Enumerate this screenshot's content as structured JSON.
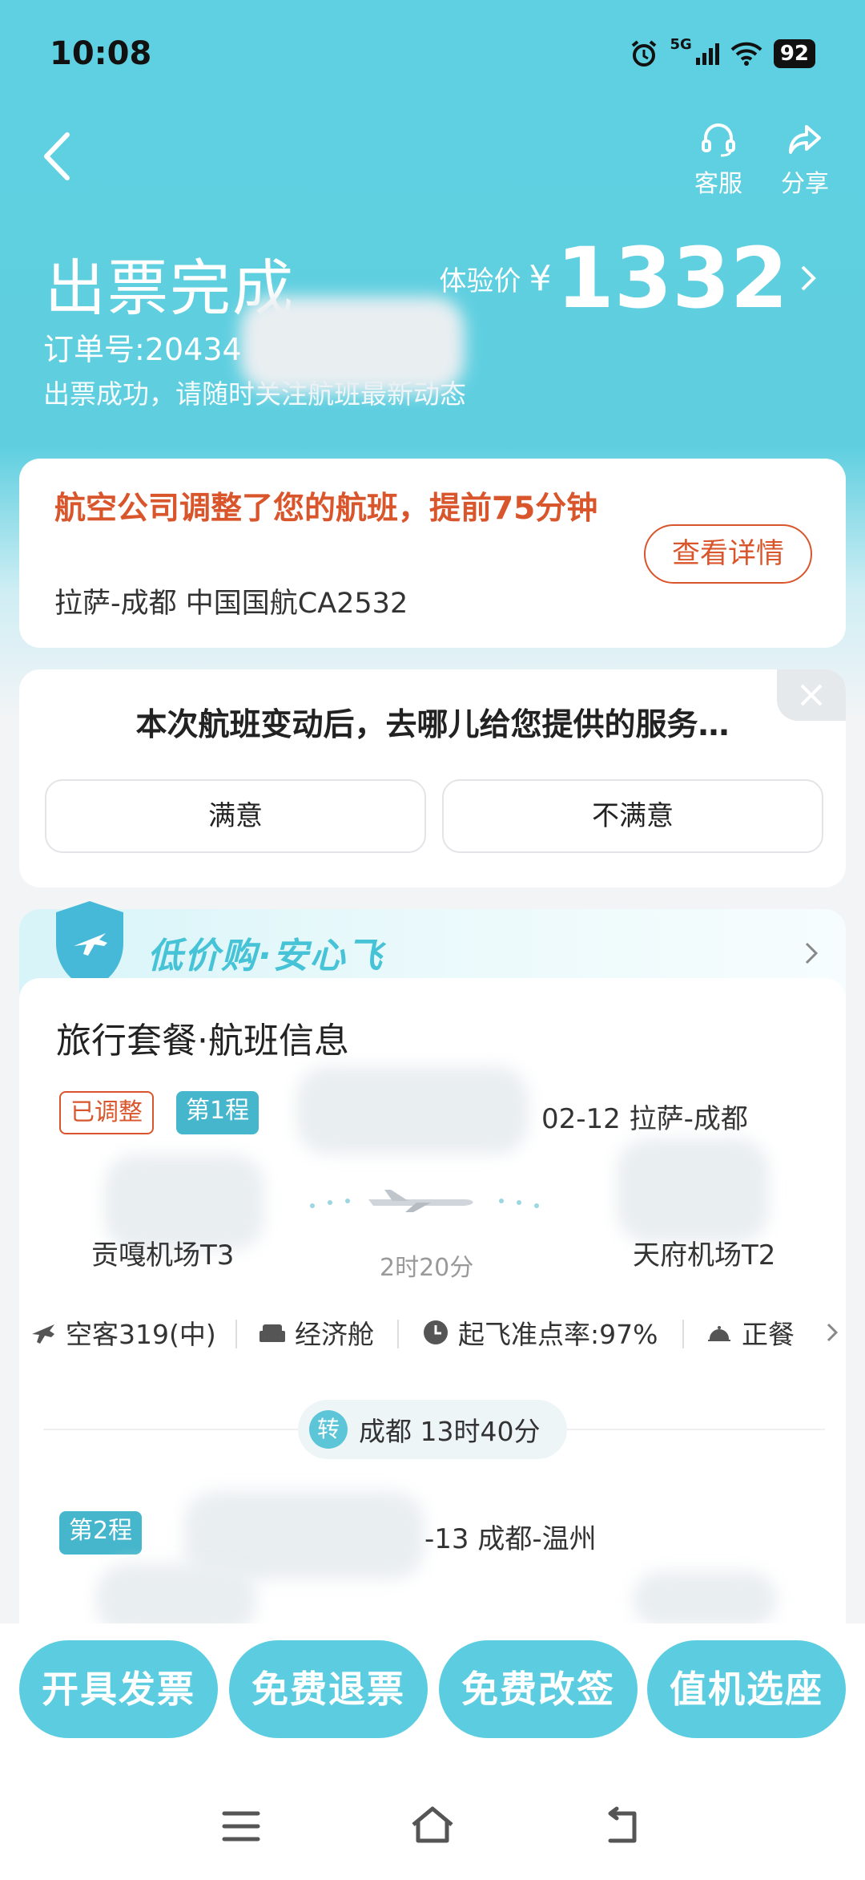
{
  "status_bar": {
    "time": "10:08",
    "network": "5G",
    "battery": "92"
  },
  "header": {
    "service_label": "客服",
    "share_label": "分享",
    "title": "出票完成",
    "order_label": "订单号:20434",
    "notice": "出票成功，请随时关注航班最新动态",
    "price_label": "体验价",
    "currency": "¥",
    "price": "1332"
  },
  "alert": {
    "title": "航空公司调整了您的航班，提前75分钟",
    "route": "拉萨-成都  中国国航CA2532",
    "detail_button": "查看详情"
  },
  "survey": {
    "question": "本次航班变动后，去哪儿给您提供的服务…",
    "satisfied": "满意",
    "unsatisfied": "不满意"
  },
  "banner": {
    "text": "低价购·安心飞"
  },
  "trip": {
    "section_title": "旅行套餐·航班信息",
    "leg1": {
      "adjusted_tag": "已调整",
      "leg_tag": "第1程",
      "date_route": "02-12 拉萨-成都",
      "dep_airport": "贡嘎机场T3",
      "arr_airport": "天府机场T2",
      "duration": "2时20分"
    },
    "features": {
      "aircraft": "空客319(中)",
      "cabin": "经济舱",
      "on_time": "起飞准点率:97%",
      "meal": "正餐"
    },
    "transfer": {
      "badge": "转",
      "text": "成都 13时40分"
    },
    "leg2": {
      "leg_tag": "第2程",
      "date_route": "-13 成都-温州"
    }
  },
  "actions": {
    "invoice": "开具发票",
    "refund": "免费退票",
    "change": "免费改签",
    "checkin": "值机选座"
  },
  "colors": {
    "accent": "#5FD0E1",
    "warning": "#D9552B",
    "button": "#5CCDE0"
  }
}
